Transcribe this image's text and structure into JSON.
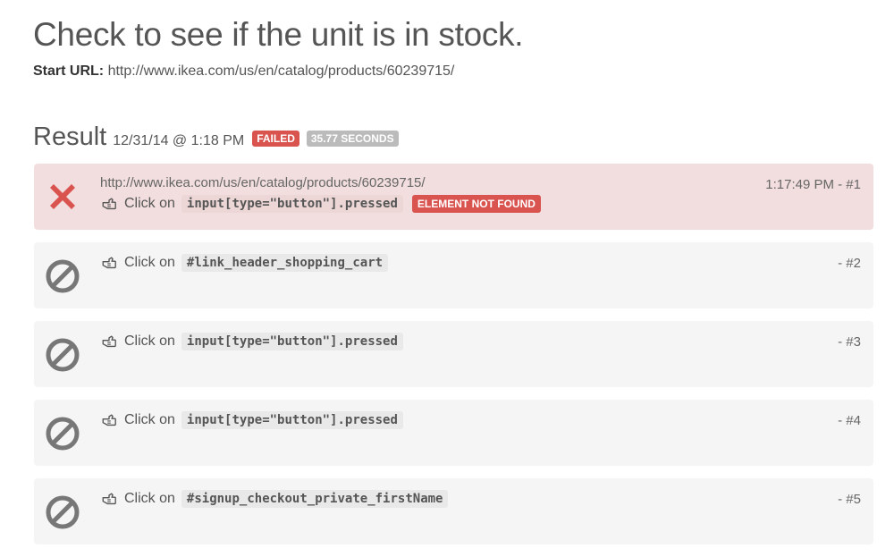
{
  "test": {
    "title": "Check to see if the unit is in stock.",
    "start_url_label": "Start URL:",
    "start_url": "http://www.ikea.com/us/en/catalog/products/60239715/"
  },
  "result": {
    "title": "Result",
    "timestamp": "12/31/14 @ 1:18 PM",
    "status_badge": "FAILED",
    "duration_badge": "35.77 SECONDS"
  },
  "colors": {
    "failed": "#d9534f",
    "failed_bg": "#f2dede",
    "skipped_bg": "#f5f5f5",
    "skipped_icon": "#777777"
  },
  "steps": [
    {
      "status": "failed",
      "status_icon": "x-icon",
      "url": "http://www.ikea.com/us/en/catalog/products/60239715/",
      "action": "Click on",
      "action_icon": "hand-pointer-icon",
      "selector": "input[type=\"button\"].pressed",
      "error": "ELEMENT NOT FOUND",
      "meta": "1:17:49 PM - #1"
    },
    {
      "status": "skipped",
      "status_icon": "ban-icon",
      "action": "Click on",
      "action_icon": "hand-pointer-icon",
      "selector": "#link_header_shopping_cart",
      "meta": "- #2"
    },
    {
      "status": "skipped",
      "status_icon": "ban-icon",
      "action": "Click on",
      "action_icon": "hand-pointer-icon",
      "selector": "input[type=\"button\"].pressed",
      "meta": "- #3"
    },
    {
      "status": "skipped",
      "status_icon": "ban-icon",
      "action": "Click on",
      "action_icon": "hand-pointer-icon",
      "selector": "input[type=\"button\"].pressed",
      "meta": "- #4"
    },
    {
      "status": "skipped",
      "status_icon": "ban-icon",
      "action": "Click on",
      "action_icon": "hand-pointer-icon",
      "selector": "#signup_checkout_private_firstName",
      "meta": "- #5"
    }
  ]
}
